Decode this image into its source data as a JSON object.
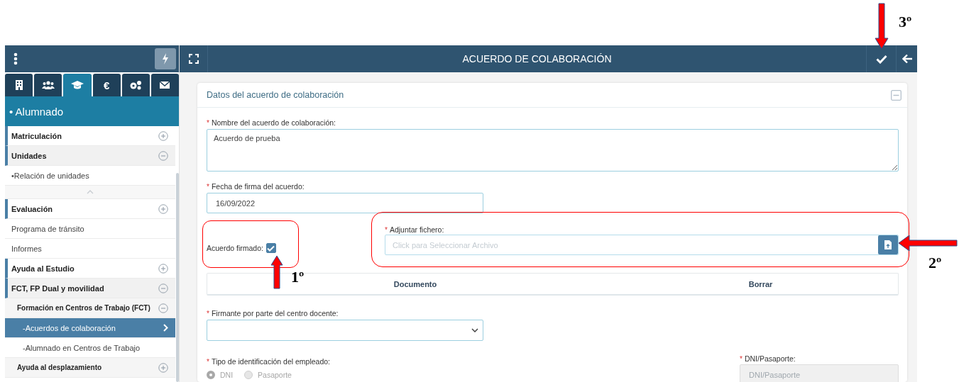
{
  "sidebar": {
    "tabs": [
      {
        "kind": "icon",
        "selected": false
      },
      {
        "kind": "icon",
        "selected": false
      },
      {
        "kind": "icon",
        "selected": true
      },
      {
        "kind": "text",
        "label": "€",
        "selected": false
      },
      {
        "kind": "icon",
        "selected": false
      },
      {
        "kind": "icon",
        "selected": false
      }
    ],
    "section_title": "• Alumnado",
    "menu": [
      {
        "kind": "group",
        "label": "Matriculación",
        "expanded": false
      },
      {
        "kind": "group",
        "label": "Unidades",
        "expanded": true
      },
      {
        "kind": "link",
        "label": "•Relación de unidades",
        "selected": false
      },
      {
        "kind": "collapse"
      },
      {
        "kind": "group",
        "label": "Evaluación",
        "expanded": false
      },
      {
        "kind": "link",
        "label": "Programa de tránsito",
        "selected": false
      },
      {
        "kind": "link",
        "label": "Informes",
        "selected": false
      },
      {
        "kind": "group",
        "label": "Ayuda al Estudio",
        "expanded": false
      },
      {
        "kind": "group",
        "label": "FCT, FP Dual y movilidad",
        "expanded": true
      },
      {
        "kind": "subgroup",
        "label": "Formación en Centros de Trabajo (FCT)",
        "expanded": true
      },
      {
        "kind": "sublink",
        "label": "-Acuerdos de colaboración",
        "selected": true
      },
      {
        "kind": "sublink",
        "label": "-Alumnado en Centros de Trabajo",
        "selected": false
      },
      {
        "kind": "subgroup",
        "label": "Ayuda al desplazamiento",
        "expanded": false
      }
    ]
  },
  "header": {
    "title": "ACUERDO DE COLABORACIÓN"
  },
  "card": {
    "title": "Datos del acuerdo de colaboración",
    "name_field": {
      "marker": "*",
      "label": "Nombre del acuerdo de colaboración:",
      "value": "Acuerdo de prueba"
    },
    "date_field": {
      "marker": "*",
      "label": "Fecha de firma del acuerdo:",
      "value": "16/09/2022"
    },
    "signed": {
      "label": "Acuerdo firmado:",
      "checked": true
    },
    "file_field": {
      "marker": "*",
      "label": "Adjuntar fichero:",
      "placeholder": "Click para Seleccionar Archivo"
    },
    "table": {
      "columns": [
        "Documento",
        "Borrar"
      ]
    },
    "signer_field": {
      "marker": "*",
      "label": "Firmante por parte del centro docente:"
    },
    "id_type": {
      "marker": "*",
      "label": "Tipo de identificación del empleado:",
      "disabled": true,
      "options": [
        {
          "label": "DNI",
          "selected": true
        },
        {
          "label": "Pasaporte",
          "selected": false
        }
      ]
    },
    "id_field": {
      "marker": "*",
      "label": "DNI/Pasaporte:",
      "disabled": true,
      "placeholder": "DNI/Pasaporte"
    }
  },
  "annotations": [
    {
      "label": "1º",
      "kind": "arrow-up"
    },
    {
      "label": "2º",
      "kind": "arrow-left"
    },
    {
      "label": "3º",
      "kind": "arrow-down"
    }
  ]
}
